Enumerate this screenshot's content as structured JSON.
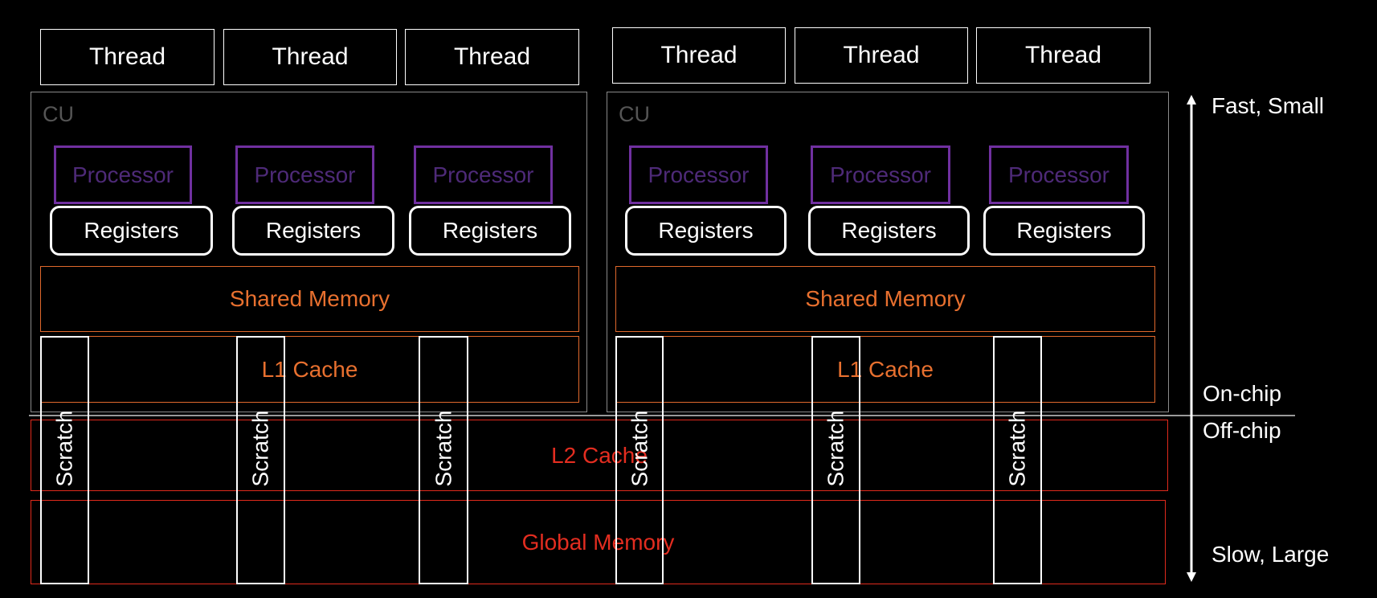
{
  "thread_label": "Thread",
  "cu_label": "CU",
  "processor_label": "Processor",
  "registers_label": "Registers",
  "shared_memory_label": "Shared Memory",
  "l1_cache_label": "L1 Cache",
  "l2_cache_label": "L2 Cache",
  "global_memory_label": "Global Memory",
  "scratch_label": "Scratch",
  "axis": {
    "top": "Fast, Small",
    "on_chip": "On-chip",
    "off_chip": "Off-chip",
    "bottom": "Slow, Large"
  },
  "colors": {
    "processor": "#7030a0",
    "cu_memory": "#e0682c",
    "off_chip_memory": "#e02a1c"
  }
}
